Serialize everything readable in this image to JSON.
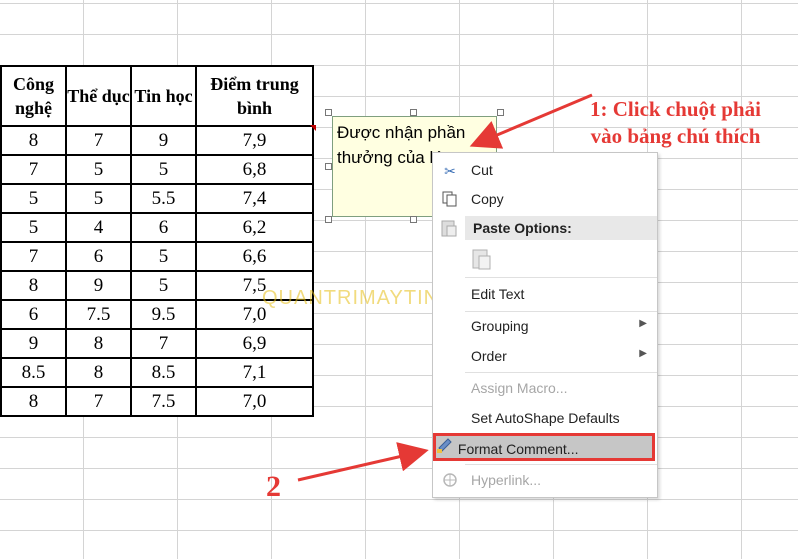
{
  "table": {
    "headers": [
      "Công nghệ",
      "Thể dục",
      "Tin học",
      "Điểm trung bình"
    ],
    "rows": [
      [
        "8",
        "7",
        "9",
        "7,9"
      ],
      [
        "7",
        "5",
        "5",
        "6,8"
      ],
      [
        "5",
        "5",
        "5.5",
        "7,4"
      ],
      [
        "5",
        "4",
        "6",
        "6,2"
      ],
      [
        "7",
        "6",
        "5",
        "6,6"
      ],
      [
        "8",
        "9",
        "5",
        "7,5"
      ],
      [
        "6",
        "7.5",
        "9.5",
        "7,0"
      ],
      [
        "9",
        "8",
        "7",
        "6,9"
      ],
      [
        "8.5",
        "8",
        "8.5",
        "7,1"
      ],
      [
        "8",
        "7",
        "7.5",
        "7,0"
      ]
    ]
  },
  "comment": {
    "text": "Được nhận phần thưởng của lớp"
  },
  "context_menu": {
    "cut": "Cut",
    "copy": "Copy",
    "paste_options": "Paste Options:",
    "edit_text": "Edit Text",
    "grouping": "Grouping",
    "order": "Order",
    "assign_macro": "Assign Macro...",
    "set_autoshape_defaults": "Set AutoShape Defaults",
    "format_comment": "Format Comment...",
    "hyperlink": "Hyperlink..."
  },
  "annotations": {
    "step1_line1": "1: Click chuột phải",
    "step1_line2": "vào bảng chú thích",
    "step2": "2"
  },
  "watermark": "QUANTRIMAYTINH.COM",
  "colors": {
    "annotation": "#e53935",
    "comment_bg": "#ffffe1",
    "highlight_bg": "#c6c6c6"
  }
}
